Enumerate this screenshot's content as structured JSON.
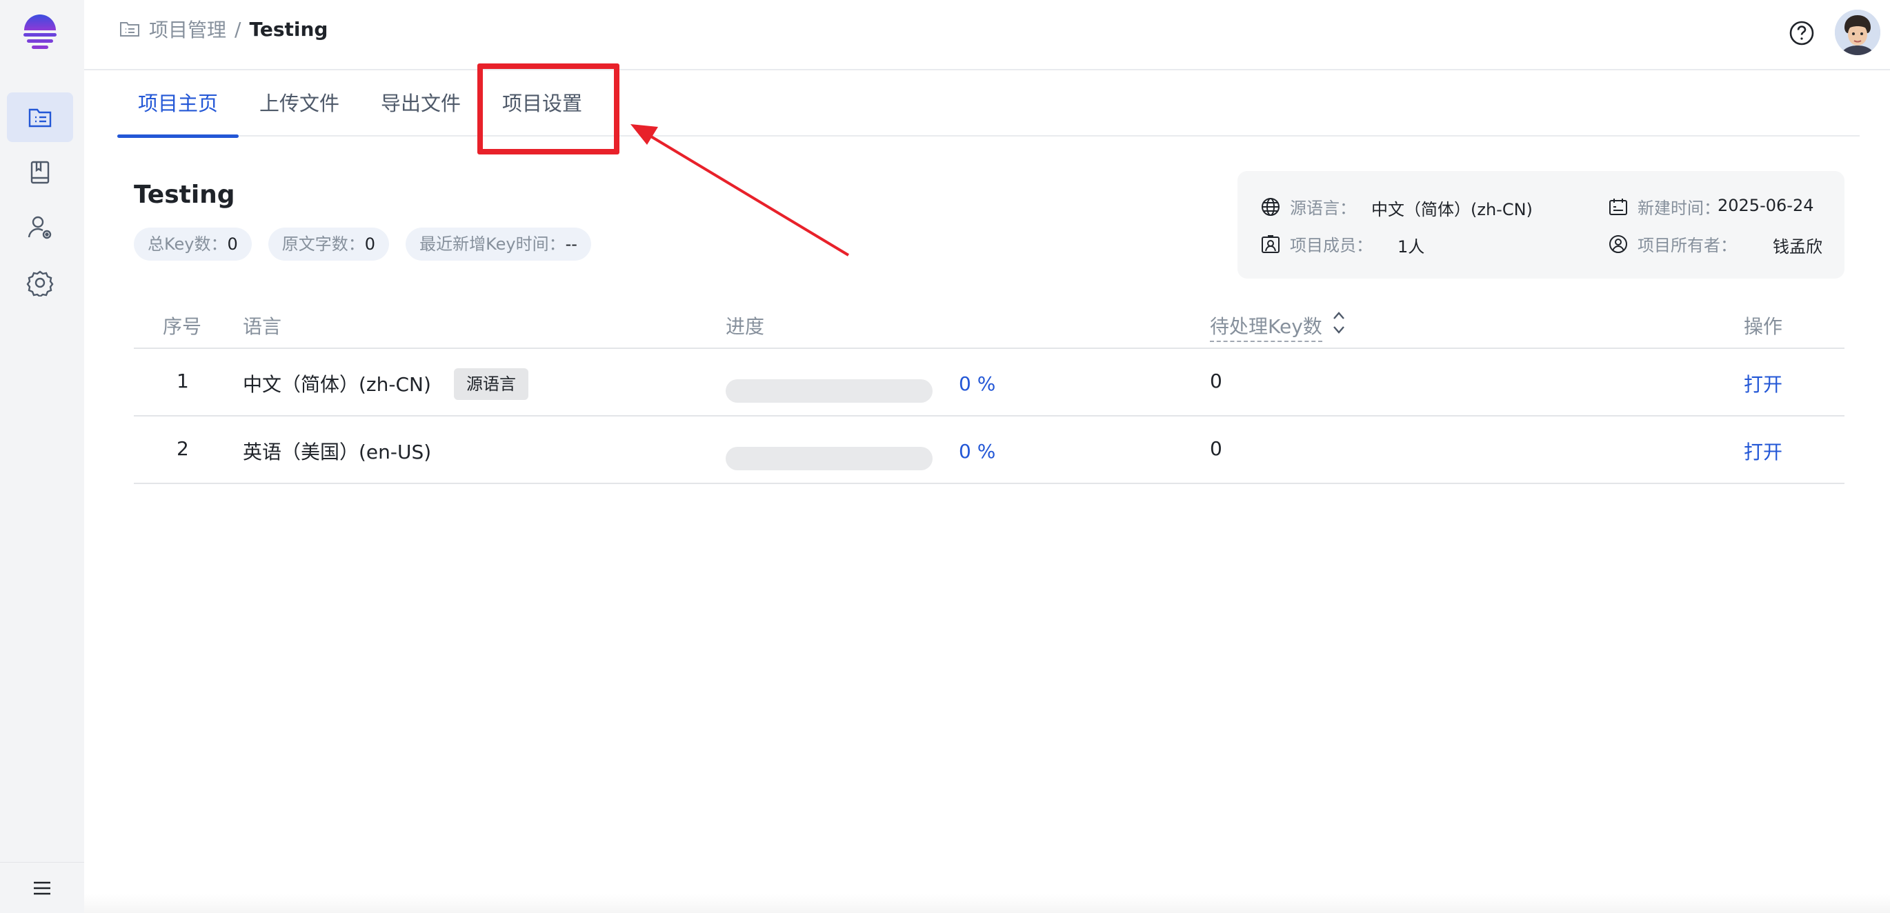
{
  "breadcrumb": {
    "parent": "项目管理",
    "separator": "/",
    "current": "Testing"
  },
  "sidebar": {
    "items": [
      {
        "icon": "project-list-icon",
        "active": true
      },
      {
        "icon": "book-icon",
        "active": false
      },
      {
        "icon": "user-settings-icon",
        "active": false
      },
      {
        "icon": "gear-icon",
        "active": false
      }
    ],
    "bottom_icon": "menu-icon"
  },
  "tabs": [
    {
      "label": "项目主页",
      "active": true
    },
    {
      "label": "上传文件",
      "active": false
    },
    {
      "label": "导出文件",
      "active": false
    },
    {
      "label": "项目设置",
      "active": false
    }
  ],
  "project": {
    "title": "Testing",
    "stats": [
      {
        "label": "总Key数：",
        "value": "0"
      },
      {
        "label": "原文字数：",
        "value": "0"
      },
      {
        "label": "最近新增Key时间：",
        "value": "--"
      }
    ]
  },
  "info": {
    "source_language_label": "源语言：",
    "source_language_value": "中文（简体）(zh-CN)",
    "created_label": "新建时间：",
    "created_value": "2025-06-24",
    "members_label": "项目成员：",
    "members_value": "1人",
    "owner_label": "项目所有者：",
    "owner_value": "钱孟欣"
  },
  "table": {
    "headers": {
      "index": "序号",
      "language": "语言",
      "progress": "进度",
      "pending": "待处理Key数",
      "action": "操作"
    },
    "rows": [
      {
        "index": "1",
        "language": "中文（简体）(zh-CN)",
        "tag": "源语言",
        "progress": 0,
        "progress_text": "0 %",
        "pending": "0",
        "action": "打开"
      },
      {
        "index": "2",
        "language": "英语（美国）(en-US)",
        "tag": "",
        "progress": 0,
        "progress_text": "0 %",
        "pending": "0",
        "action": "打开"
      }
    ]
  },
  "colors": {
    "accent": "#2357d6",
    "highlight": "#e8212a",
    "sidebar_bg": "#f3f4f6"
  }
}
